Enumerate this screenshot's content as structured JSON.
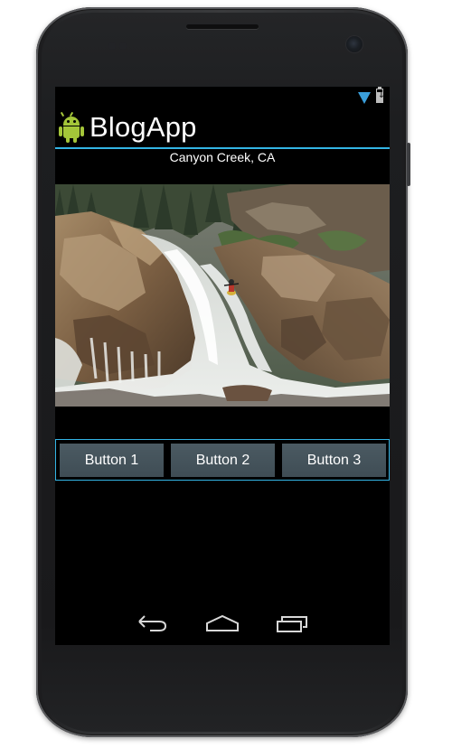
{
  "app": {
    "title": "BlogApp"
  },
  "status_bar": {
    "icons": [
      "wifi-icon",
      "battery-icon"
    ],
    "wifi_color": "#3a9fdb"
  },
  "content": {
    "location": "Canyon Creek, CA",
    "photo_description": "Kayaker descending a waterfall between granite rocks"
  },
  "buttons": [
    {
      "label": "Button 1"
    },
    {
      "label": "Button 2"
    },
    {
      "label": "Button 3"
    }
  ],
  "nav_bar": {
    "icons": [
      "back-icon",
      "home-icon",
      "recents-icon"
    ]
  },
  "colors": {
    "accent": "#33b5e5",
    "button_bg": "#435159",
    "screen_bg": "#000000",
    "android_green": "#a4c639"
  }
}
